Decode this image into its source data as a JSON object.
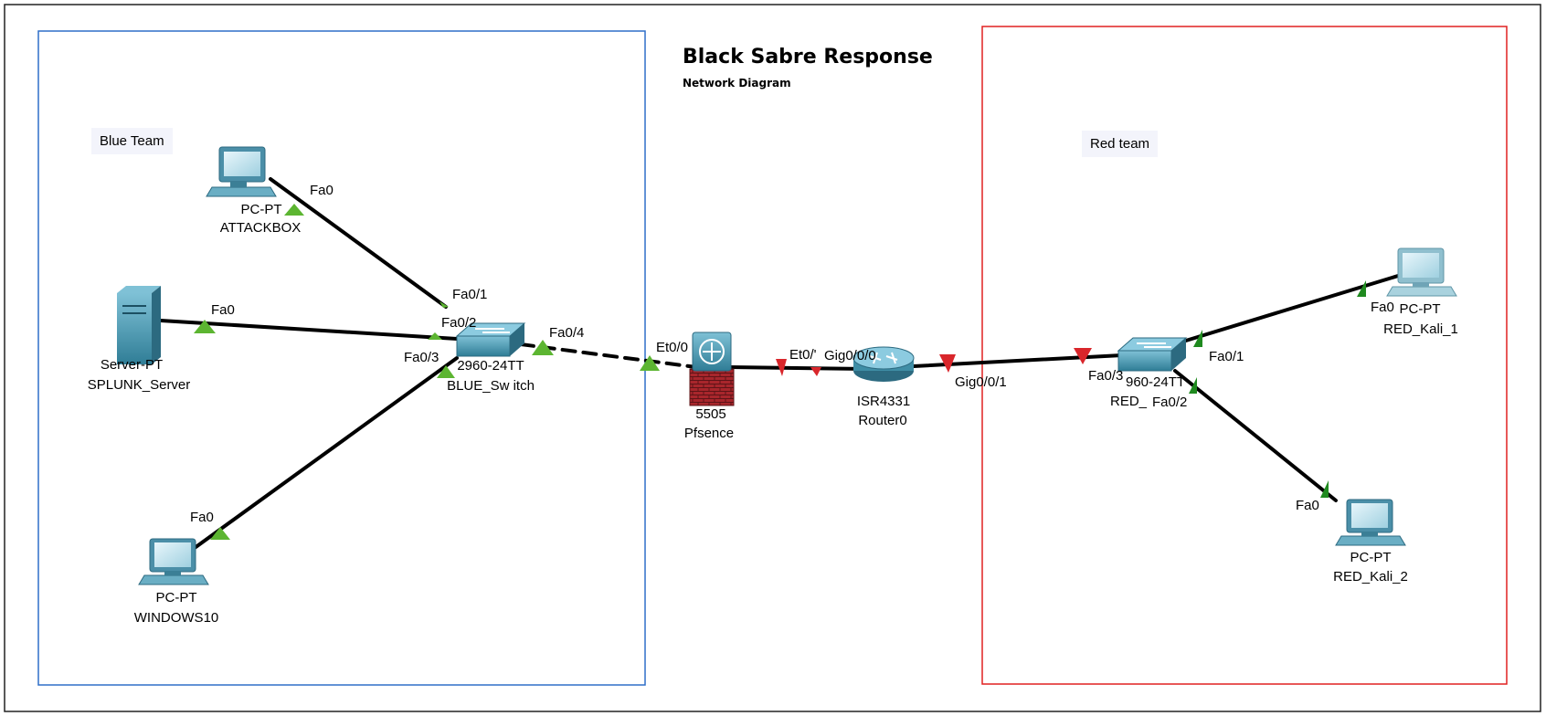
{
  "title": "Black Sabre Response",
  "subtitle": "Network Diagram",
  "zones": {
    "blue": {
      "label": "Blue Team",
      "color": "#2f6fc9"
    },
    "red": {
      "label": "Red team",
      "color": "#e02020"
    }
  },
  "devices": {
    "attackbox": {
      "type": "PC-PT",
      "name": "ATTACKBOX"
    },
    "splunk": {
      "type": "Server-PT",
      "name": "SPLUNK_Server"
    },
    "windows10": {
      "type": "PC-PT",
      "name": "WINDOWS10"
    },
    "blue_switch": {
      "type": "2960-24TT",
      "name": "BLUE_Sw itch"
    },
    "pfsense": {
      "type": "5505",
      "name": "Pfsence"
    },
    "router": {
      "type": "ISR4331",
      "name": "Router0"
    },
    "red_switch": {
      "type": "960-24TT",
      "name": "RED_"
    },
    "red_kali_1": {
      "type": "PC-PT",
      "name": "RED_Kali_1"
    },
    "red_kali_2": {
      "type": "PC-PT",
      "name": "RED_Kali_2"
    }
  },
  "ports": {
    "attackbox_fa0": "Fa0",
    "sw_fa01": "Fa0/1",
    "splunk_fa0": "Fa0",
    "sw_fa02": "Fa0/2",
    "sw_fa03": "Fa0/3",
    "sw_fa04": "Fa0/4",
    "win_fa0": "Fa0",
    "pf_et00": "Et0/0",
    "pf_et01": "Et0/'",
    "r_gig000": "Gig0/0/0",
    "r_gig001": "Gig0/0/1",
    "rsw_fa03": "Fa0/3",
    "rsw_fa01": "Fa0/1",
    "rsw_fa02": "Fa0/2",
    "kali1_fa0": "Fa0",
    "kali2_fa0": "Fa0"
  },
  "colors": {
    "link_up": "#5cb531",
    "link_up_dark": "#1f8a1f",
    "link_down": "#d9262b",
    "device": "#3f8ea6"
  }
}
